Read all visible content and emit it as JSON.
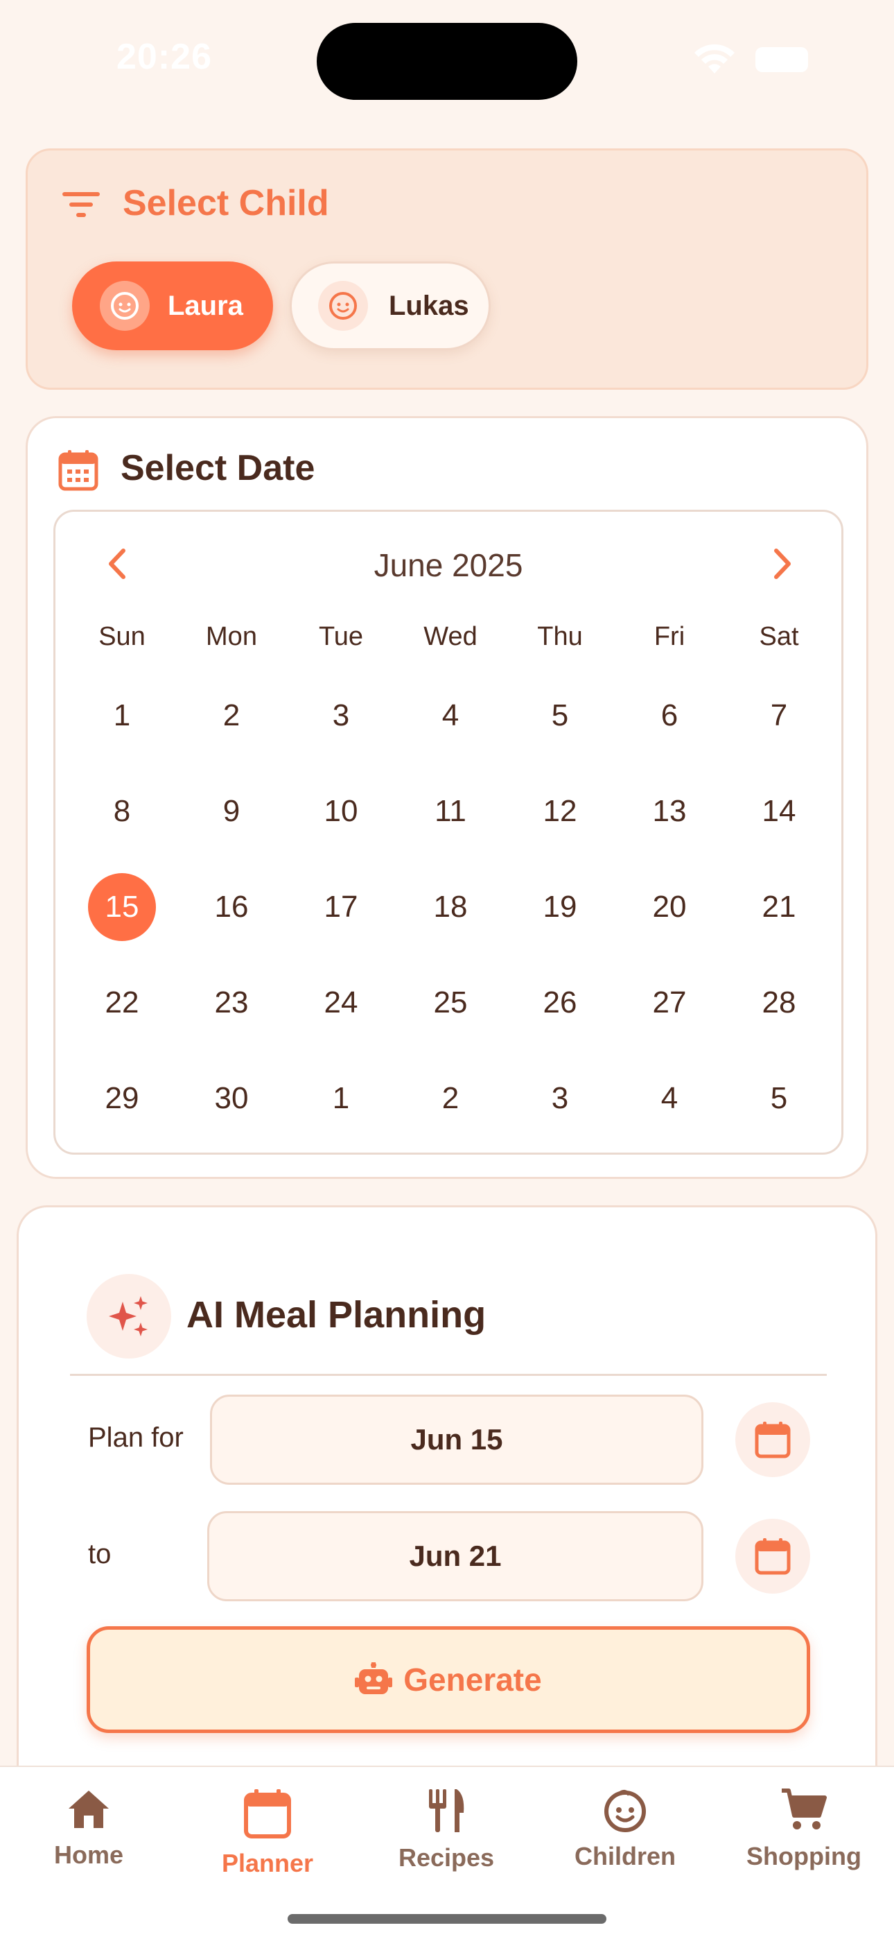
{
  "status_bar": {
    "time": "20:26"
  },
  "child_selector": {
    "title": "Select Child",
    "children": [
      {
        "name": "Laura",
        "selected": true
      },
      {
        "name": "Lukas",
        "selected": false
      }
    ]
  },
  "date_selector": {
    "title": "Select Date",
    "calendar": {
      "month_label": "June 2025",
      "weekdays": [
        "Sun",
        "Mon",
        "Tue",
        "Wed",
        "Thu",
        "Fri",
        "Sat"
      ],
      "weeks": [
        [
          "1",
          "2",
          "3",
          "4",
          "5",
          "6",
          "7"
        ],
        [
          "8",
          "9",
          "10",
          "11",
          "12",
          "13",
          "14"
        ],
        [
          "15",
          "16",
          "17",
          "18",
          "19",
          "20",
          "21"
        ],
        [
          "22",
          "23",
          "24",
          "25",
          "26",
          "27",
          "28"
        ],
        [
          "29",
          "30",
          "1",
          "2",
          "3",
          "4",
          "5"
        ]
      ],
      "selected_day": "15"
    }
  },
  "ai_planning": {
    "title": "AI Meal Planning",
    "plan_for_label": "Plan for",
    "start_date": "Jun 15",
    "to_label": "to",
    "end_date": "Jun 21",
    "generate_label": "Generate"
  },
  "tab_bar": {
    "tabs": [
      {
        "label": "Home",
        "icon": "home-icon",
        "active": false
      },
      {
        "label": "Planner",
        "icon": "calendar-icon",
        "active": true
      },
      {
        "label": "Recipes",
        "icon": "utensils-icon",
        "active": false
      },
      {
        "label": "Children",
        "icon": "child-face-icon",
        "active": false
      },
      {
        "label": "Shopping",
        "icon": "cart-icon",
        "active": false
      }
    ]
  },
  "colors": {
    "accent": "#ff6f45",
    "accent_text": "#f5764a",
    "background": "#fdf4ee",
    "text_dark": "#4a2a1e",
    "tab_inactive": "#8a6a5a"
  }
}
